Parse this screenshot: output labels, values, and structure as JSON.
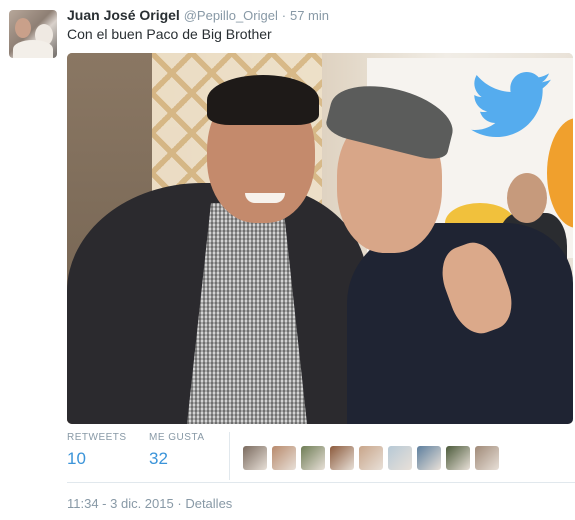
{
  "tweet": {
    "author_name": "Juan José Origel",
    "author_handle": "@Pepillo_Origel",
    "separator": "·",
    "relative_time": "57 min",
    "text": "Con el buen Paco de Big Brother"
  },
  "stats": {
    "retweets_label": "RETWEETS",
    "retweets_count": "10",
    "likes_label": "ME GUSTA",
    "likes_count": "32",
    "liker_avatars": [
      "#7a6a5e",
      "#b88a6c",
      "#6e7d55",
      "#8c5a3c",
      "#c8a58a",
      "#b7c9d6",
      "#5d7f9e",
      "#4b5a3a",
      "#a08a78"
    ]
  },
  "footer": {
    "timestamp": "11:34 - 3 dic. 2015",
    "separator": "·",
    "details_label": "Detalles"
  },
  "colors": {
    "link_blue": "#3b94d9",
    "muted_gray": "#8899a6",
    "text_dark": "#292f33",
    "twitter_bird": "#55acee"
  }
}
